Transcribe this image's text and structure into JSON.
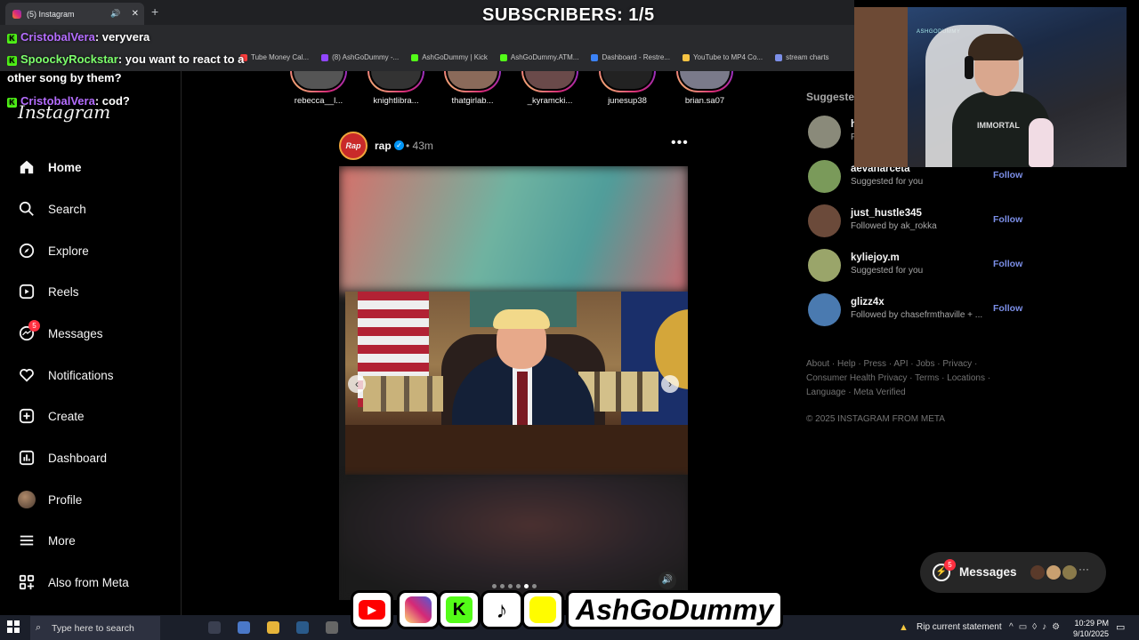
{
  "browser": {
    "tab_title": "(5) Instagram",
    "new_tab": "+",
    "bookmarks": [
      {
        "label": "Tube Money Cal...",
        "color": "#ff3d3d"
      },
      {
        "label": "(8) AshGoDummy -...",
        "color": "#9146ff"
      },
      {
        "label": "AshGoDummy | Kick",
        "color": "#53fc18"
      },
      {
        "label": "AshGoDummy.ATM...",
        "color": "#53fc18"
      },
      {
        "label": "Dashboard - Restre...",
        "color": "#3b82f6"
      },
      {
        "label": "YouTube to MP4 Co...",
        "color": "#f6c343"
      },
      {
        "label": "stream charts",
        "color": "#7c8fe8"
      }
    ]
  },
  "stream_overlay": {
    "subscribers": "SUBSCRIBERS: 1/5",
    "chat": [
      {
        "user": "CristobalVera",
        "message": ": veryvera"
      },
      {
        "user": "SpoockyRockstar",
        "message": ": you want to react to a"
      },
      {
        "user": "",
        "message": "other song by them?"
      },
      {
        "user": "CristobalVera",
        "message": ": cod?"
      }
    ],
    "channel_name": "AshGoDummy",
    "webcam_shirt_text": "IMMORTAL",
    "webcam_sign": "ASHGODUMMY"
  },
  "instagram": {
    "logo": "Instagram",
    "nav": [
      {
        "label": "Home",
        "icon": "home-icon"
      },
      {
        "label": "Search",
        "icon": "search-icon"
      },
      {
        "label": "Explore",
        "icon": "compass-icon"
      },
      {
        "label": "Reels",
        "icon": "reels-icon"
      },
      {
        "label": "Messages",
        "icon": "messenger-icon",
        "badge": "5"
      },
      {
        "label": "Notifications",
        "icon": "heart-icon"
      },
      {
        "label": "Create",
        "icon": "plus-square-icon"
      },
      {
        "label": "Dashboard",
        "icon": "chart-icon"
      },
      {
        "label": "Profile",
        "icon": "avatar-icon"
      },
      {
        "label": "More",
        "icon": "menu-icon"
      },
      {
        "label": "Also from Meta",
        "icon": "grid-icon"
      }
    ],
    "stories": [
      "rebecca__l...",
      "knightlibra...",
      "thatgirlab...",
      "_kyramcki...",
      "junesup38",
      "brian.sa07"
    ],
    "post": {
      "user": "rap",
      "verified": "✓",
      "time": "• 43m",
      "avatar_text": "Rap",
      "more": "•••",
      "carousel_count": 6,
      "carousel_active": 5
    },
    "suggested_title": "Suggested",
    "suggestions": [
      {
        "user": "h",
        "sub": "F",
        "follow": "",
        "color": "#8a8a7a"
      },
      {
        "user": "aevanarceta",
        "sub": "Suggested for you",
        "follow": "Follow",
        "color": "#7a9a5a"
      },
      {
        "user": "just_hustle345",
        "sub": "Followed by ak_rokka",
        "follow": "Follow",
        "color": "#6b4a3a"
      },
      {
        "user": "kyliejoy.m",
        "sub": "Suggested for you",
        "follow": "Follow",
        "color": "#9aa56a"
      },
      {
        "user": "glizz4x",
        "sub": "Followed by chasefrmthaville + ...",
        "follow": "Follow",
        "color": "#4a7ab0"
      }
    ],
    "footer_links": "About · Help · Press · API · Jobs · Privacy · Consumer Health Privacy · Terms · Locations · Language · Meta Verified",
    "copyright": "© 2025 INSTAGRAM FROM META",
    "messages_pill": {
      "label": "Messages",
      "badge": "5"
    }
  },
  "taskbar": {
    "search_placeholder": "Type here to search",
    "news": "Rip current statement",
    "time": "10:29 PM",
    "date": "9/10/2025"
  },
  "colors": {
    "accent": "#0095f6",
    "badge": "#ff3040",
    "follow": "#7c8fe8"
  }
}
